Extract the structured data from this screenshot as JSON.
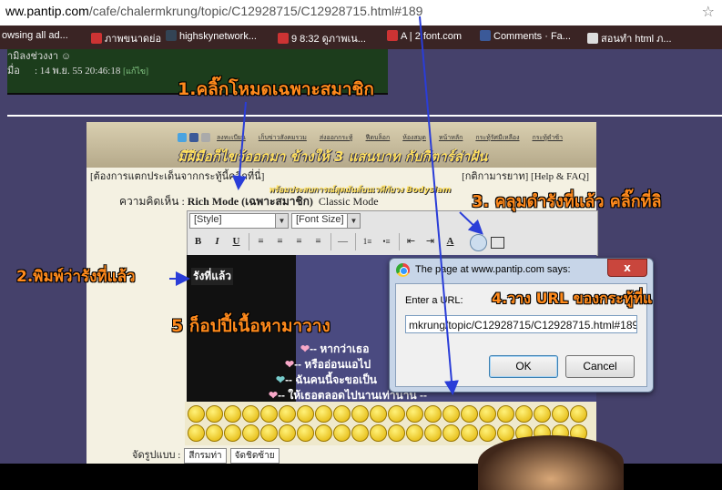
{
  "browser": {
    "url_prefix": "ww.pantip.com",
    "url_rest": "/cafe/chalermkrung/topic/C12928715/C12928715.html#189",
    "bookmarks": [
      "owsing all ad...",
      "ภาพขนาดย่อ",
      "highskynetwork...",
      "9 8:32 ดูภาพเน...",
      "A | 2 font.com",
      "Comments · Fa...",
      "สอนทำ html ภ..."
    ]
  },
  "old_post": {
    "name_row": "ามิลงช่วงงา ☺",
    "date_label": "มื่อ",
    "date_value": ": 14 พ.ย. 55 20:46:18",
    "edit_label": "[แก้ไข]"
  },
  "forum": {
    "nav_items": [
      "ลงทะเบียน",
      "เก็บข่าวสังคมรวม",
      "ส่งออกกระทู้",
      "ฟีดบล็อก",
      "ห้องสมุด",
      "หน้าหลัก",
      "กระทู้รัศมีเหลือง",
      "กระทู้ดำซ้า"
    ],
    "banner_title": "มีฝีมือก็ไขว้ออกมา ข้างให้ 3 แสนบาท กับกีตาร์ล่าฝัน",
    "banner_sub": "พร้อมประสบการณ์สุดมันส์บนเวทีกับวง Bodyslam",
    "hint_left": "[ต้องการแตกประเด็นจากกระทู้นี้คลิกที่นี่]",
    "hint_right": "[กติกามารยาท] [Help & FAQ]",
    "mode_label": "ความคิดเห็น :",
    "mode_rich": "Rich Mode (เฉพาะสมาชิก)",
    "mode_classic": "Classic Mode",
    "style_select": "[Style]",
    "fontsize_select": "[Font Size]",
    "toolbar_buttons": [
      "B",
      "I",
      "U",
      "≡",
      "≡",
      "≡",
      "≡",
      "—",
      "1≡",
      "•≡",
      "⇤",
      "⇥",
      "A",
      "🔗",
      "▭"
    ],
    "typed_text": "รังที่แล้ว",
    "poem_lines": [
      "-- หากว่าเธอ",
      "-- หรืออ่อนแอไป",
      "-- ฉันคนนี้จะขอเป็น",
      "-- ให้เธอตลอดไปนานเท่านาน --"
    ],
    "style_row_label": "จัดรูปแบบ :",
    "style_row_opts": [
      "สีกรมท่า",
      "จัดชิดซ้าย"
    ]
  },
  "dialog": {
    "title": "The page at www.pantip.com says:",
    "close_label": "x",
    "prompt_label": "Enter a URL:",
    "url_value": "mkrung/topic/C12928715/C12928715.html#189",
    "ok_label": "OK",
    "cancel_label": "Cancel"
  },
  "annotations": {
    "step1": "1.คลิ๊กโหมดเฉพาะสมาชิก",
    "step2": "2.พิมพ์ว่ารังที่แล้ว",
    "step3": "3. คลุมดำรังที่แล้ว   คลิ๊กที่ลิ",
    "step4": "4.วาง URL ของกระทู้ที่แ",
    "step5": "5 ก็อปปี้เนื้อหามาวาง"
  },
  "colors": {
    "annotation": "#ff8a1c",
    "arrow": "#2a3dd8",
    "page_bg": "#45416b",
    "content_bg": "#4a4a80"
  }
}
